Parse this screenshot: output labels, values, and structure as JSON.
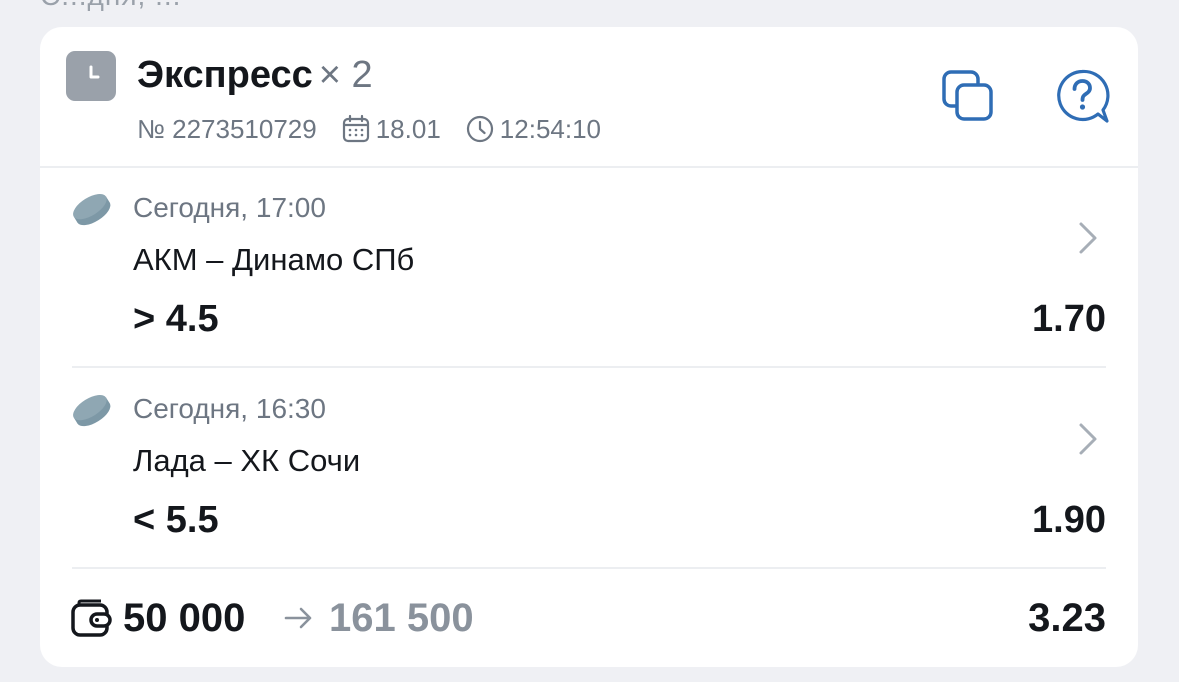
{
  "top_fragment": "С...дня, ...",
  "header": {
    "title": "Экспресс",
    "multiplier": "× 2",
    "number": "№ 2273510729",
    "date": "18.01",
    "time": "12:54:10",
    "status_icon": "clock-icon",
    "actions": [
      {
        "name": "copy",
        "icon": "copy-icon"
      },
      {
        "name": "help",
        "icon": "help-question-icon"
      }
    ]
  },
  "events": [
    {
      "sport_icon": "hockey-puck-icon",
      "time": "Сегодня, 17:00",
      "name": "АКМ – Динамо СПб",
      "outcome": "> 4.5",
      "odds": "1.70"
    },
    {
      "sport_icon": "hockey-puck-icon",
      "time": "Сегодня, 16:30",
      "name": "Лада – ХК Сочи",
      "outcome": "< 5.5",
      "odds": "1.90"
    }
  ],
  "footer": {
    "stake": "50 000",
    "payout": "161 500",
    "total_odds": "3.23"
  },
  "colors": {
    "background": "#eff0f4",
    "card": "#ffffff",
    "text_primary": "#14171c",
    "text_secondary": "#6d7682",
    "accent_blue": "#2f6db5",
    "badge_grey": "#9aa1aa",
    "puck": "#7d98a6"
  }
}
